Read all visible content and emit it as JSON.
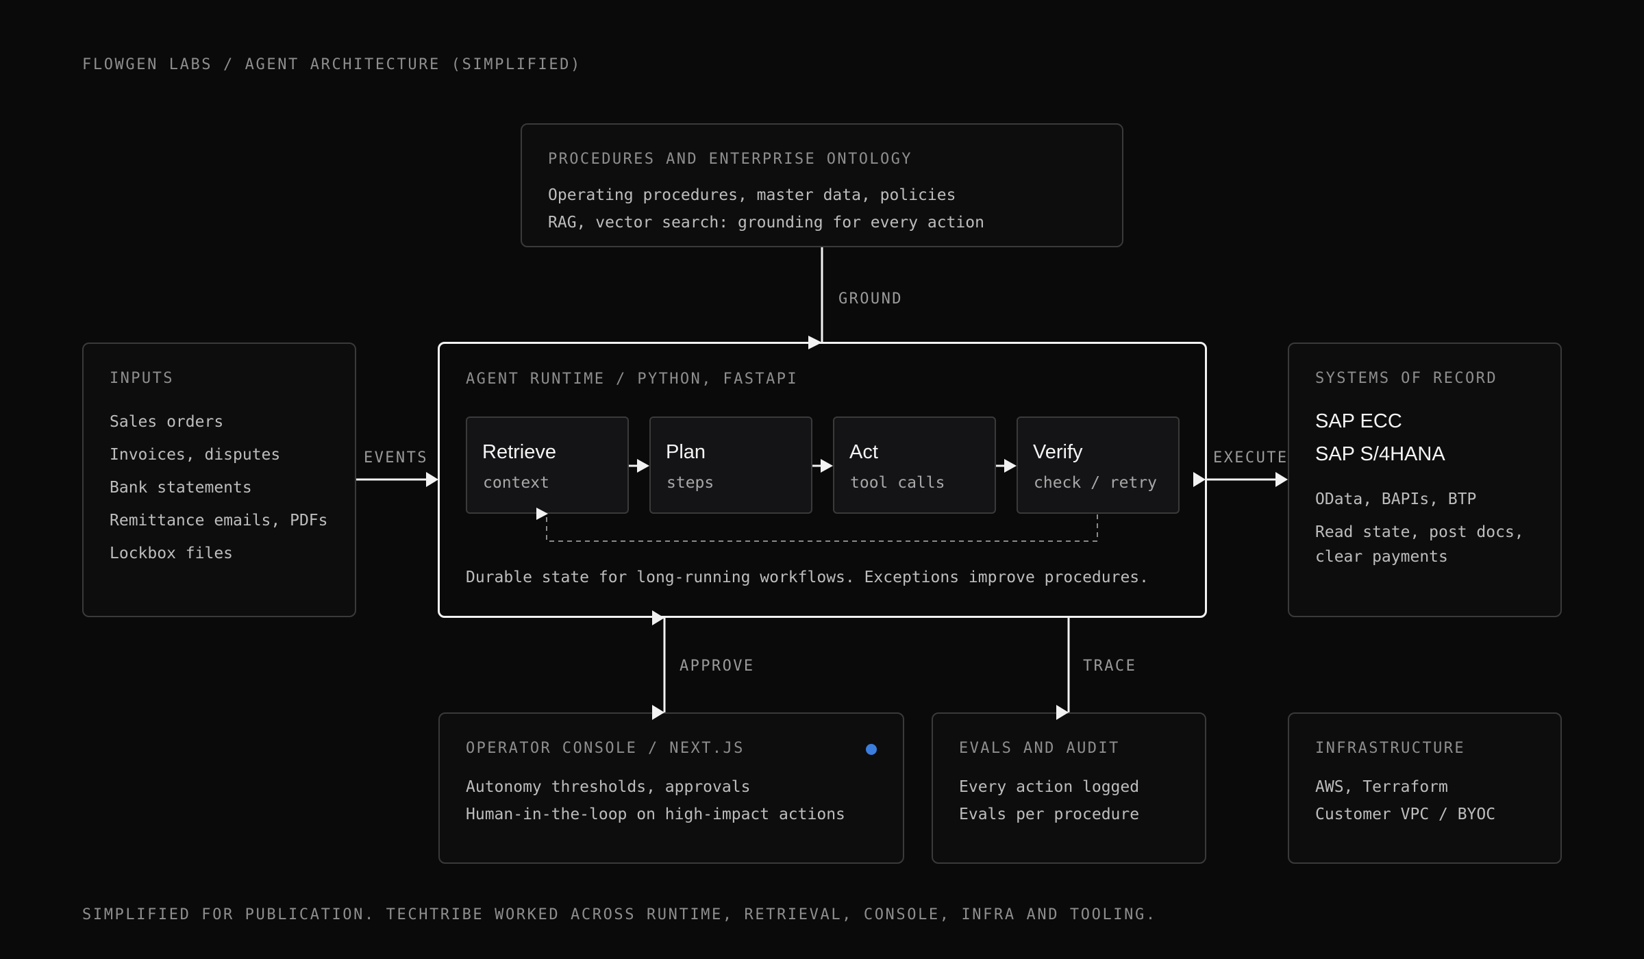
{
  "header": "FLOWGEN LABS / AGENT ARCHITECTURE (SIMPLIFIED)",
  "footer": "SIMPLIFIED FOR PUBLICATION. TECHTRIBE WORKED ACROSS RUNTIME, RETRIEVAL, CONSOLE, INFRA AND TOOLING.",
  "procedures": {
    "title": "PROCEDURES AND ENTERPRISE ONTOLOGY",
    "lines": [
      "Operating procedures, master data, policies",
      "RAG, vector search: grounding for every action"
    ]
  },
  "inputs": {
    "title": "INPUTS",
    "items": [
      "Sales orders",
      "Invoices, disputes",
      "Bank statements",
      "Remittance emails, PDFs",
      "Lockbox files"
    ]
  },
  "runtime": {
    "title": "AGENT RUNTIME / PYTHON, FASTAPI",
    "steps": [
      {
        "title": "Retrieve",
        "sub": "context"
      },
      {
        "title": "Plan",
        "sub": "steps"
      },
      {
        "title": "Act",
        "sub": "tool calls"
      },
      {
        "title": "Verify",
        "sub": "check / retry"
      }
    ],
    "note": "Durable state for long-running workflows. Exceptions improve procedures."
  },
  "systems": {
    "title": "SYSTEMS OF RECORD",
    "primary": [
      "SAP ECC",
      "SAP S/4HANA"
    ],
    "secondary": "OData, BAPIs, BTP",
    "detail": [
      "Read state, post docs,",
      "clear payments"
    ]
  },
  "console": {
    "title": "OPERATOR CONSOLE / NEXT.JS",
    "lines": [
      "Autonomy thresholds, approvals",
      "Human-in-the-loop on high-impact actions"
    ],
    "status_color": "#3b7ddd"
  },
  "evals": {
    "title": "EVALS AND AUDIT",
    "lines": [
      "Every action logged",
      "Evals per procedure"
    ]
  },
  "infra": {
    "title": "INFRASTRUCTURE",
    "lines": [
      "AWS, Terraform",
      "Customer VPC / BYOC"
    ]
  },
  "connectors": {
    "ground": "GROUND",
    "events": "EVENTS",
    "execute": "EXECUTE",
    "approve": "APPROVE",
    "trace": "TRACE"
  }
}
